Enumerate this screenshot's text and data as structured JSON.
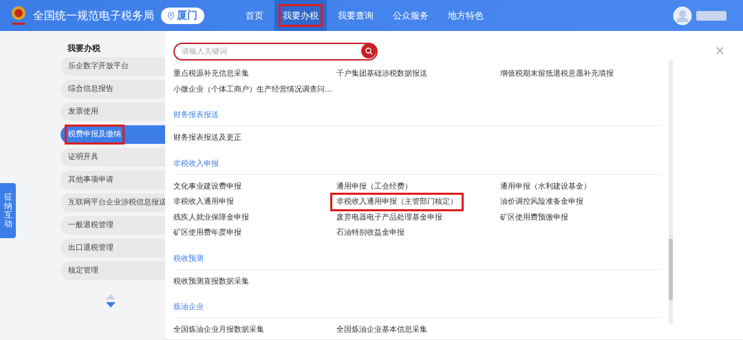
{
  "header": {
    "site_title": "全国统一规范电子税务局",
    "city": "厦门",
    "nav": [
      {
        "label": "首页",
        "selected": false,
        "highlighted": false
      },
      {
        "label": "我要办税",
        "selected": true,
        "highlighted": true
      },
      {
        "label": "我要查询",
        "selected": false,
        "highlighted": false
      },
      {
        "label": "公众服务",
        "selected": false,
        "highlighted": false
      },
      {
        "label": "地方特色",
        "selected": false,
        "highlighted": false
      }
    ]
  },
  "side_tab": {
    "label": "征纳互动"
  },
  "sidebar": {
    "title": "我要办税",
    "items": [
      {
        "label": "乐企数字开放平台",
        "selected": false,
        "highlighted": false
      },
      {
        "label": "综合信息报告",
        "selected": false,
        "highlighted": false
      },
      {
        "label": "发票使用",
        "selected": false,
        "highlighted": false
      },
      {
        "label": "税费申报及缴纳",
        "selected": true,
        "highlighted": true
      },
      {
        "label": "证明开具",
        "selected": false,
        "highlighted": false
      },
      {
        "label": "其他事项申请",
        "selected": false,
        "highlighted": false
      },
      {
        "label": "互联网平台企业涉税信息报送",
        "selected": false,
        "highlighted": false
      },
      {
        "label": "一般退税管理",
        "selected": false,
        "highlighted": false
      },
      {
        "label": "出口退税管理",
        "selected": false,
        "highlighted": false
      },
      {
        "label": "核定管理",
        "selected": false,
        "highlighted": false
      }
    ]
  },
  "search": {
    "placeholder": "请输入关键词"
  },
  "sections": [
    {
      "items": [
        {
          "label": "重点税源补充信息采集",
          "highlighted": false
        },
        {
          "label": "千户集团基础涉税数据报送",
          "highlighted": false
        },
        {
          "label": "增值税期末留抵退税意愿补充填报",
          "highlighted": false
        },
        {
          "label": "小微企业（个体工商户）生产经营情况调查问...",
          "highlighted": false
        }
      ]
    },
    {
      "heading": "财务报表报送",
      "items": [
        {
          "label": "财务报表报送及更正",
          "highlighted": false
        }
      ]
    },
    {
      "heading": "非税收入申报",
      "items": [
        {
          "label": "文化事业建设费申报",
          "highlighted": false
        },
        {
          "label": "通用申报（工会经费）",
          "highlighted": false
        },
        {
          "label": "通用申报（水利建设基金）",
          "highlighted": false
        },
        {
          "label": "非税收入通用申报",
          "highlighted": false
        },
        {
          "label": "非税收入通用申报（主管部门核定）",
          "highlighted": true
        },
        {
          "label": "油价调控风险准备金申报",
          "highlighted": false
        },
        {
          "label": "残疾人就业保障金申报",
          "highlighted": false
        },
        {
          "label": "废弃电器电子产品处理基金申报",
          "highlighted": false
        },
        {
          "label": "矿区使用费预缴申报",
          "highlighted": false
        },
        {
          "label": "矿区使用费年度申报",
          "highlighted": false
        },
        {
          "label": "石油特别收益金申报",
          "highlighted": false
        }
      ]
    },
    {
      "heading": "税收预测",
      "items": [
        {
          "label": "税收预测直报数据采集",
          "highlighted": false
        }
      ]
    },
    {
      "heading": "炼油企业",
      "items": [
        {
          "label": "全国炼油企业月报数据采集",
          "highlighted": false
        },
        {
          "label": "全国炼油企业基本信息采集",
          "highlighted": false
        }
      ]
    }
  ]
}
